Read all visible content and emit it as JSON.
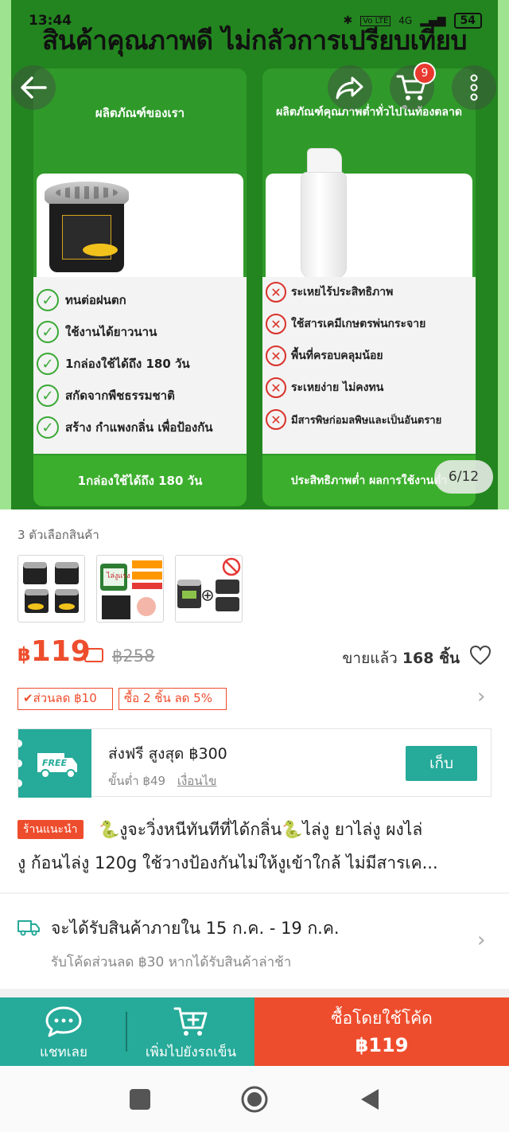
{
  "status_bar": {
    "time": "13:44",
    "network": "4G",
    "volte": "Vo LTE",
    "battery": "54"
  },
  "top_nav": {
    "cart_count": "9"
  },
  "hero": {
    "headline": "สินค้าคุณภาพดี ไม่กลัวการเปรียบเทียบ",
    "left": {
      "title": "ผลิตภัณฑ์ของเรา",
      "items": [
        "ทนต่อฝนตก",
        "ใช้งานได้ยาวนาน",
        "1กล่องใช้ได้ถึง 180 วัน",
        "สกัดจากพืชธรรมชาติ",
        "สร้าง กำแพงกลิ่น เพื่อป้องกัน"
      ],
      "bottom": "1กล่องใช้ได้ถึง 180 วัน"
    },
    "right": {
      "title": "ผลิตภัณฑ์คุณภาพต่ำทั่วไปในท้องตลาด",
      "items": [
        "ระเหยไร้ประสิทธิภาพ",
        "ใช้สารเคมีเกษตรพ่นกระจาย",
        "พื้นที่ครอบคลุมน้อย",
        "ระเหยง่าย ไม่คงทน",
        "มีสารพิษก่อมลพิษและเป็นอันตราย"
      ],
      "bottom": "ประสิทธิภาพต่ำ ผลการใช้งานต่ำ"
    },
    "pager": "6/12",
    "colors": {
      "background": "#9ee38f",
      "panel": "#2f9a2a",
      "check": "#3aa935",
      "cross": "#d9322a"
    }
  },
  "variants": {
    "label": "3 ตัวเลือกสินค้า",
    "thumb_text": "ไล่งูแรง"
  },
  "price": {
    "currency": "฿",
    "current": "119",
    "original": "฿258",
    "sold_label": "ขายแล้ว",
    "sold_count": "168 ชิ้น",
    "accent": "#ee4d2d"
  },
  "coupons": [
    "✔ส่วนลด ฿10",
    "ซื้อ 2 ชิ้น ลด 5%"
  ],
  "shipping_voucher": {
    "badge": "FREE",
    "title": "ส่งฟรี สูงสุด ฿300",
    "min_spend": "ขั้นต่ำ ฿49",
    "conditions": "เงื่อนไข",
    "collect": "เก็บ",
    "accent": "#26aa99"
  },
  "product": {
    "tag": "ร้านแนะนำ",
    "title_line1": "🐍งูจะวิ่งหนีทันทีที่ได้กลิ่น🐍ไล่งู ยาไล่งู ผงไล่",
    "title_line2": "งู ก้อนไล่งู 120g ใช้วางป้องกันไม่ให้งูเข้าใกล้  ไม่มีสารเค..."
  },
  "delivery": {
    "title": "จะได้รับสินค้าภายใน 15 ก.ค. - 19 ก.ค.",
    "subtitle": "รับโค้ดส่วนลด ฿30 หากได้รับสินค้าล่าช้า"
  },
  "actions": {
    "chat": "แชทเลย",
    "add_to_cart": "เพิ่มไปยังรถเข็น",
    "buy_label": "ซื้อโดยใช้โค้ด",
    "buy_price": "฿119"
  }
}
